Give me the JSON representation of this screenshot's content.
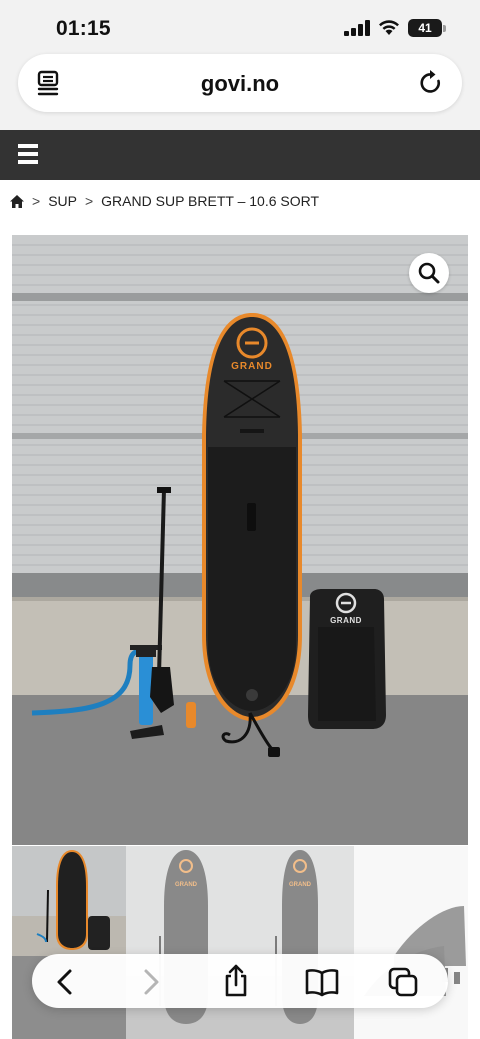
{
  "status_bar": {
    "time": "01:15",
    "battery": "41"
  },
  "browser": {
    "domain": "govi.no",
    "icons": [
      "reader-icon",
      "reload-icon"
    ],
    "toolbar_icons": [
      "back-icon",
      "forward-icon",
      "share-icon",
      "bookmarks-icon",
      "tabs-icon"
    ]
  },
  "site": {
    "menu_icon": "hamburger-icon"
  },
  "breadcrumb": {
    "items": [
      "SUP",
      "GRAND SUP BRETT – 10.6 SORT"
    ],
    "separator": ">"
  },
  "product": {
    "brand_board": "GRAND",
    "brand_bag": "GRAND",
    "zoom_icon": "magnifier-icon"
  },
  "thumbnails": {
    "brand": "GRAND"
  },
  "colors": {
    "nav_bg": "#333333",
    "board_accent": "#e8892b",
    "pump_blue": "#1e7fc0"
  }
}
